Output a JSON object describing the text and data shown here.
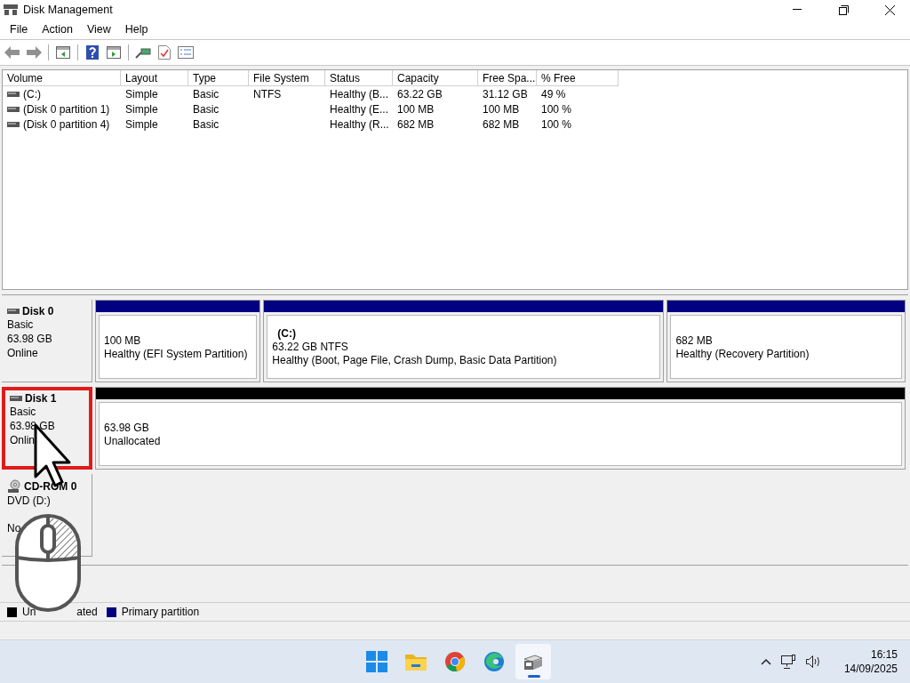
{
  "window": {
    "title": "Disk Management"
  },
  "menu": [
    "File",
    "Action",
    "View",
    "Help"
  ],
  "table": {
    "columns": [
      "Volume",
      "Layout",
      "Type",
      "File System",
      "Status",
      "Capacity",
      "Free Spa...",
      "% Free"
    ],
    "rows": [
      [
        "(C:)",
        "Simple",
        "Basic",
        "NTFS",
        "Healthy (B...",
        "63.22 GB",
        "31.12 GB",
        "49 %"
      ],
      [
        "(Disk 0 partition 1)",
        "Simple",
        "Basic",
        "",
        "Healthy (E...",
        "100 MB",
        "100 MB",
        "100 %"
      ],
      [
        "(Disk 0 partition 4)",
        "Simple",
        "Basic",
        "",
        "Healthy (R...",
        "682 MB",
        "682 MB",
        "100 %"
      ]
    ]
  },
  "disks": [
    {
      "kind": "disk",
      "name": "Disk 0",
      "lines": [
        "Basic",
        "63.98 GB",
        "Online"
      ],
      "highlighted": false,
      "partitions": [
        {
          "color": "#000080",
          "lines": [
            "100 MB",
            "Healthy (EFI System Partition)"
          ]
        },
        {
          "color": "#000080",
          "title": "(C:)",
          "lines": [
            "63.22 GB NTFS",
            "Healthy (Boot, Page File, Crash Dump, Basic Data Partition)"
          ]
        },
        {
          "color": "#000080",
          "lines": [
            "682 MB",
            "Healthy (Recovery Partition)"
          ]
        }
      ]
    },
    {
      "kind": "disk",
      "name": "Disk 1",
      "lines": [
        "Basic",
        "63.98 GB",
        "Onlin"
      ],
      "highlighted": true,
      "partitions": [
        {
          "color": "#000000",
          "lines": [
            "63.98 GB",
            "Unallocated"
          ]
        }
      ]
    },
    {
      "kind": "cdrom",
      "name": "CD-ROM 0",
      "lines": [
        "DVD (D:)",
        "No"
      ],
      "highlighted": false
    }
  ],
  "legend": [
    {
      "color": "#000000",
      "label_parts": [
        "Un",
        "ated"
      ]
    },
    {
      "color": "#000080",
      "label_parts": [
        "Primary partition"
      ]
    }
  ],
  "taskbar": {
    "apps": [
      {
        "kind": "start",
        "selected": false
      },
      {
        "kind": "folder",
        "selected": false
      },
      {
        "kind": "browser",
        "selected": false
      },
      {
        "kind": "edge",
        "selected": false
      },
      {
        "kind": "disk",
        "selected": true
      }
    ],
    "time": "16:15",
    "date": "14/09/2025"
  }
}
